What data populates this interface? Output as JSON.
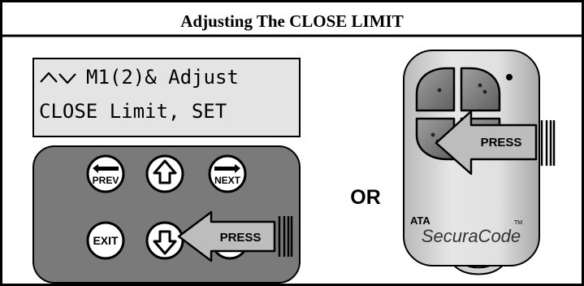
{
  "title": "Adjusting The CLOSE LIMIT",
  "lcd": {
    "line1": "M1(2)& Adjust",
    "line2": "CLOSE Limit, SET",
    "arrows_icon": "up-down-arrows-icon"
  },
  "keypad": {
    "prev_label": "PREV",
    "next_label": "NEXT",
    "exit_label": "EXIT",
    "up_icon": "up-arrow-icon",
    "down_icon": "down-arrow-icon"
  },
  "press_label_keypad": "PRESS",
  "or_label": "OR",
  "remote": {
    "press_label": "PRESS",
    "brand": "ATA",
    "product": "SecuraCode",
    "tm": "TM"
  },
  "colors": {
    "lcd_background": "#e4e4e4",
    "keypad_panel": "#7a7a7a",
    "remote_body": "#dedede",
    "arrow_fill": "#bdbdbd"
  }
}
